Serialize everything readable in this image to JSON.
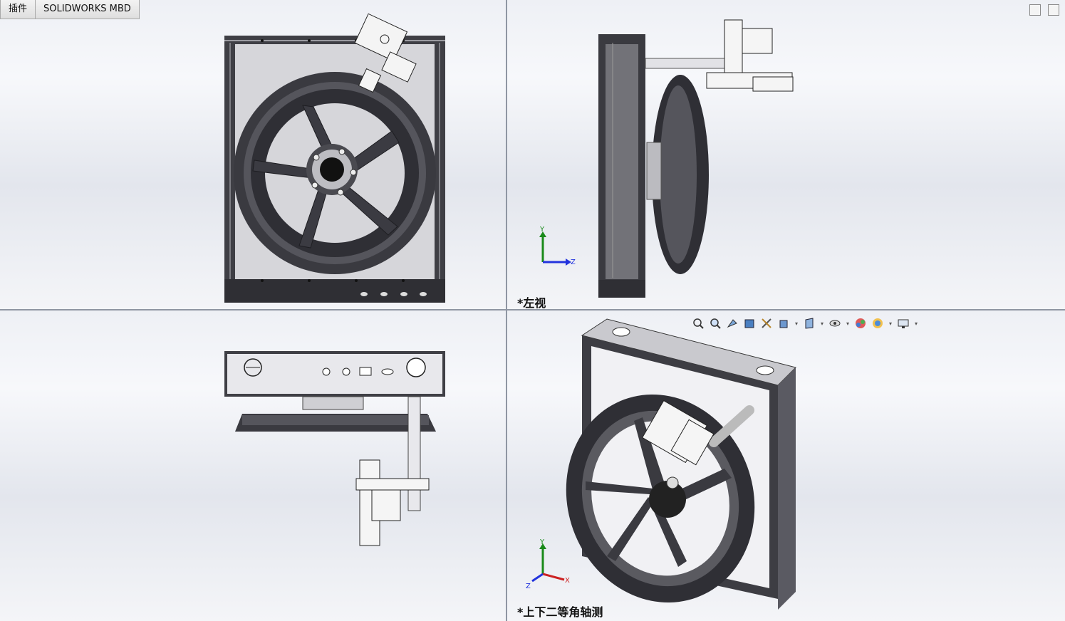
{
  "tabs": [
    {
      "label": "插件"
    },
    {
      "label": "SOLIDWORKS MBD"
    }
  ],
  "viewports": {
    "left_view": {
      "label": "*左视"
    },
    "iso_view": {
      "label": "*上下二等角轴测"
    }
  },
  "triad": {
    "left": {
      "y": "Y",
      "z": "Z"
    },
    "iso": {
      "y": "Y",
      "x": "X",
      "z": "Z"
    }
  },
  "heads_up_toolbar": [
    {
      "icon": "zoom-to-fit-icon"
    },
    {
      "icon": "zoom-to-area-icon"
    },
    {
      "icon": "previous-view-icon"
    },
    {
      "icon": "section-view-icon"
    },
    {
      "icon": "dynamic-annotation-icon"
    },
    {
      "icon": "view-orientation-icon"
    },
    {
      "icon": "display-style-icon"
    },
    {
      "icon": "hide-show-items-icon"
    },
    {
      "icon": "edit-appearance-icon"
    },
    {
      "icon": "apply-scene-icon"
    },
    {
      "icon": "view-settings-icon"
    }
  ],
  "colors": {
    "viewport_bg": "#eef0f5",
    "frame_dark": "#3f3f45",
    "panel_light": "#d4d4d8",
    "wheel_dark": "#2e2e33",
    "axis_y": "#1a8a1a",
    "axis_z": "#2233dd",
    "axis_x": "#cc2222"
  }
}
